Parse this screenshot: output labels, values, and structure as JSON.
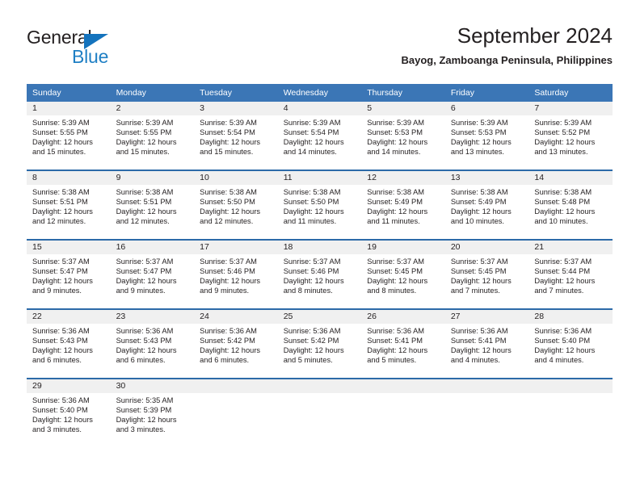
{
  "brand": {
    "name_part1": "General",
    "name_part2": "Blue",
    "triangle_icon": "triangle-icon",
    "color_dark": "#231f20",
    "color_blue": "#1f7fc4"
  },
  "header": {
    "title": "September 2024",
    "subtitle": "Bayog, Zamboanga Peninsula, Philippines"
  },
  "theme": {
    "header_blue": "#3b76b6",
    "separator_blue": "#2c6aa8",
    "daynum_band": "#f0f0f0",
    "text": "#231f20"
  },
  "calendar": {
    "weekday_headers": [
      "Sunday",
      "Monday",
      "Tuesday",
      "Wednesday",
      "Thursday",
      "Friday",
      "Saturday"
    ],
    "weeks": [
      [
        {
          "day": "1",
          "sunrise": "Sunrise: 5:39 AM",
          "sunset": "Sunset: 5:55 PM",
          "daylight1": "Daylight: 12 hours",
          "daylight2": "and 15 minutes."
        },
        {
          "day": "2",
          "sunrise": "Sunrise: 5:39 AM",
          "sunset": "Sunset: 5:55 PM",
          "daylight1": "Daylight: 12 hours",
          "daylight2": "and 15 minutes."
        },
        {
          "day": "3",
          "sunrise": "Sunrise: 5:39 AM",
          "sunset": "Sunset: 5:54 PM",
          "daylight1": "Daylight: 12 hours",
          "daylight2": "and 15 minutes."
        },
        {
          "day": "4",
          "sunrise": "Sunrise: 5:39 AM",
          "sunset": "Sunset: 5:54 PM",
          "daylight1": "Daylight: 12 hours",
          "daylight2": "and 14 minutes."
        },
        {
          "day": "5",
          "sunrise": "Sunrise: 5:39 AM",
          "sunset": "Sunset: 5:53 PM",
          "daylight1": "Daylight: 12 hours",
          "daylight2": "and 14 minutes."
        },
        {
          "day": "6",
          "sunrise": "Sunrise: 5:39 AM",
          "sunset": "Sunset: 5:53 PM",
          "daylight1": "Daylight: 12 hours",
          "daylight2": "and 13 minutes."
        },
        {
          "day": "7",
          "sunrise": "Sunrise: 5:39 AM",
          "sunset": "Sunset: 5:52 PM",
          "daylight1": "Daylight: 12 hours",
          "daylight2": "and 13 minutes."
        }
      ],
      [
        {
          "day": "8",
          "sunrise": "Sunrise: 5:38 AM",
          "sunset": "Sunset: 5:51 PM",
          "daylight1": "Daylight: 12 hours",
          "daylight2": "and 12 minutes."
        },
        {
          "day": "9",
          "sunrise": "Sunrise: 5:38 AM",
          "sunset": "Sunset: 5:51 PM",
          "daylight1": "Daylight: 12 hours",
          "daylight2": "and 12 minutes."
        },
        {
          "day": "10",
          "sunrise": "Sunrise: 5:38 AM",
          "sunset": "Sunset: 5:50 PM",
          "daylight1": "Daylight: 12 hours",
          "daylight2": "and 12 minutes."
        },
        {
          "day": "11",
          "sunrise": "Sunrise: 5:38 AM",
          "sunset": "Sunset: 5:50 PM",
          "daylight1": "Daylight: 12 hours",
          "daylight2": "and 11 minutes."
        },
        {
          "day": "12",
          "sunrise": "Sunrise: 5:38 AM",
          "sunset": "Sunset: 5:49 PM",
          "daylight1": "Daylight: 12 hours",
          "daylight2": "and 11 minutes."
        },
        {
          "day": "13",
          "sunrise": "Sunrise: 5:38 AM",
          "sunset": "Sunset: 5:49 PM",
          "daylight1": "Daylight: 12 hours",
          "daylight2": "and 10 minutes."
        },
        {
          "day": "14",
          "sunrise": "Sunrise: 5:38 AM",
          "sunset": "Sunset: 5:48 PM",
          "daylight1": "Daylight: 12 hours",
          "daylight2": "and 10 minutes."
        }
      ],
      [
        {
          "day": "15",
          "sunrise": "Sunrise: 5:37 AM",
          "sunset": "Sunset: 5:47 PM",
          "daylight1": "Daylight: 12 hours",
          "daylight2": "and 9 minutes."
        },
        {
          "day": "16",
          "sunrise": "Sunrise: 5:37 AM",
          "sunset": "Sunset: 5:47 PM",
          "daylight1": "Daylight: 12 hours",
          "daylight2": "and 9 minutes."
        },
        {
          "day": "17",
          "sunrise": "Sunrise: 5:37 AM",
          "sunset": "Sunset: 5:46 PM",
          "daylight1": "Daylight: 12 hours",
          "daylight2": "and 9 minutes."
        },
        {
          "day": "18",
          "sunrise": "Sunrise: 5:37 AM",
          "sunset": "Sunset: 5:46 PM",
          "daylight1": "Daylight: 12 hours",
          "daylight2": "and 8 minutes."
        },
        {
          "day": "19",
          "sunrise": "Sunrise: 5:37 AM",
          "sunset": "Sunset: 5:45 PM",
          "daylight1": "Daylight: 12 hours",
          "daylight2": "and 8 minutes."
        },
        {
          "day": "20",
          "sunrise": "Sunrise: 5:37 AM",
          "sunset": "Sunset: 5:45 PM",
          "daylight1": "Daylight: 12 hours",
          "daylight2": "and 7 minutes."
        },
        {
          "day": "21",
          "sunrise": "Sunrise: 5:37 AM",
          "sunset": "Sunset: 5:44 PM",
          "daylight1": "Daylight: 12 hours",
          "daylight2": "and 7 minutes."
        }
      ],
      [
        {
          "day": "22",
          "sunrise": "Sunrise: 5:36 AM",
          "sunset": "Sunset: 5:43 PM",
          "daylight1": "Daylight: 12 hours",
          "daylight2": "and 6 minutes."
        },
        {
          "day": "23",
          "sunrise": "Sunrise: 5:36 AM",
          "sunset": "Sunset: 5:43 PM",
          "daylight1": "Daylight: 12 hours",
          "daylight2": "and 6 minutes."
        },
        {
          "day": "24",
          "sunrise": "Sunrise: 5:36 AM",
          "sunset": "Sunset: 5:42 PM",
          "daylight1": "Daylight: 12 hours",
          "daylight2": "and 6 minutes."
        },
        {
          "day": "25",
          "sunrise": "Sunrise: 5:36 AM",
          "sunset": "Sunset: 5:42 PM",
          "daylight1": "Daylight: 12 hours",
          "daylight2": "and 5 minutes."
        },
        {
          "day": "26",
          "sunrise": "Sunrise: 5:36 AM",
          "sunset": "Sunset: 5:41 PM",
          "daylight1": "Daylight: 12 hours",
          "daylight2": "and 5 minutes."
        },
        {
          "day": "27",
          "sunrise": "Sunrise: 5:36 AM",
          "sunset": "Sunset: 5:41 PM",
          "daylight1": "Daylight: 12 hours",
          "daylight2": "and 4 minutes."
        },
        {
          "day": "28",
          "sunrise": "Sunrise: 5:36 AM",
          "sunset": "Sunset: 5:40 PM",
          "daylight1": "Daylight: 12 hours",
          "daylight2": "and 4 minutes."
        }
      ],
      [
        {
          "day": "29",
          "sunrise": "Sunrise: 5:36 AM",
          "sunset": "Sunset: 5:40 PM",
          "daylight1": "Daylight: 12 hours",
          "daylight2": "and 3 minutes."
        },
        {
          "day": "30",
          "sunrise": "Sunrise: 5:35 AM",
          "sunset": "Sunset: 5:39 PM",
          "daylight1": "Daylight: 12 hours",
          "daylight2": "and 3 minutes."
        },
        {
          "day": "",
          "sunrise": "",
          "sunset": "",
          "daylight1": "",
          "daylight2": ""
        },
        {
          "day": "",
          "sunrise": "",
          "sunset": "",
          "daylight1": "",
          "daylight2": ""
        },
        {
          "day": "",
          "sunrise": "",
          "sunset": "",
          "daylight1": "",
          "daylight2": ""
        },
        {
          "day": "",
          "sunrise": "",
          "sunset": "",
          "daylight1": "",
          "daylight2": ""
        },
        {
          "day": "",
          "sunrise": "",
          "sunset": "",
          "daylight1": "",
          "daylight2": ""
        }
      ]
    ]
  }
}
